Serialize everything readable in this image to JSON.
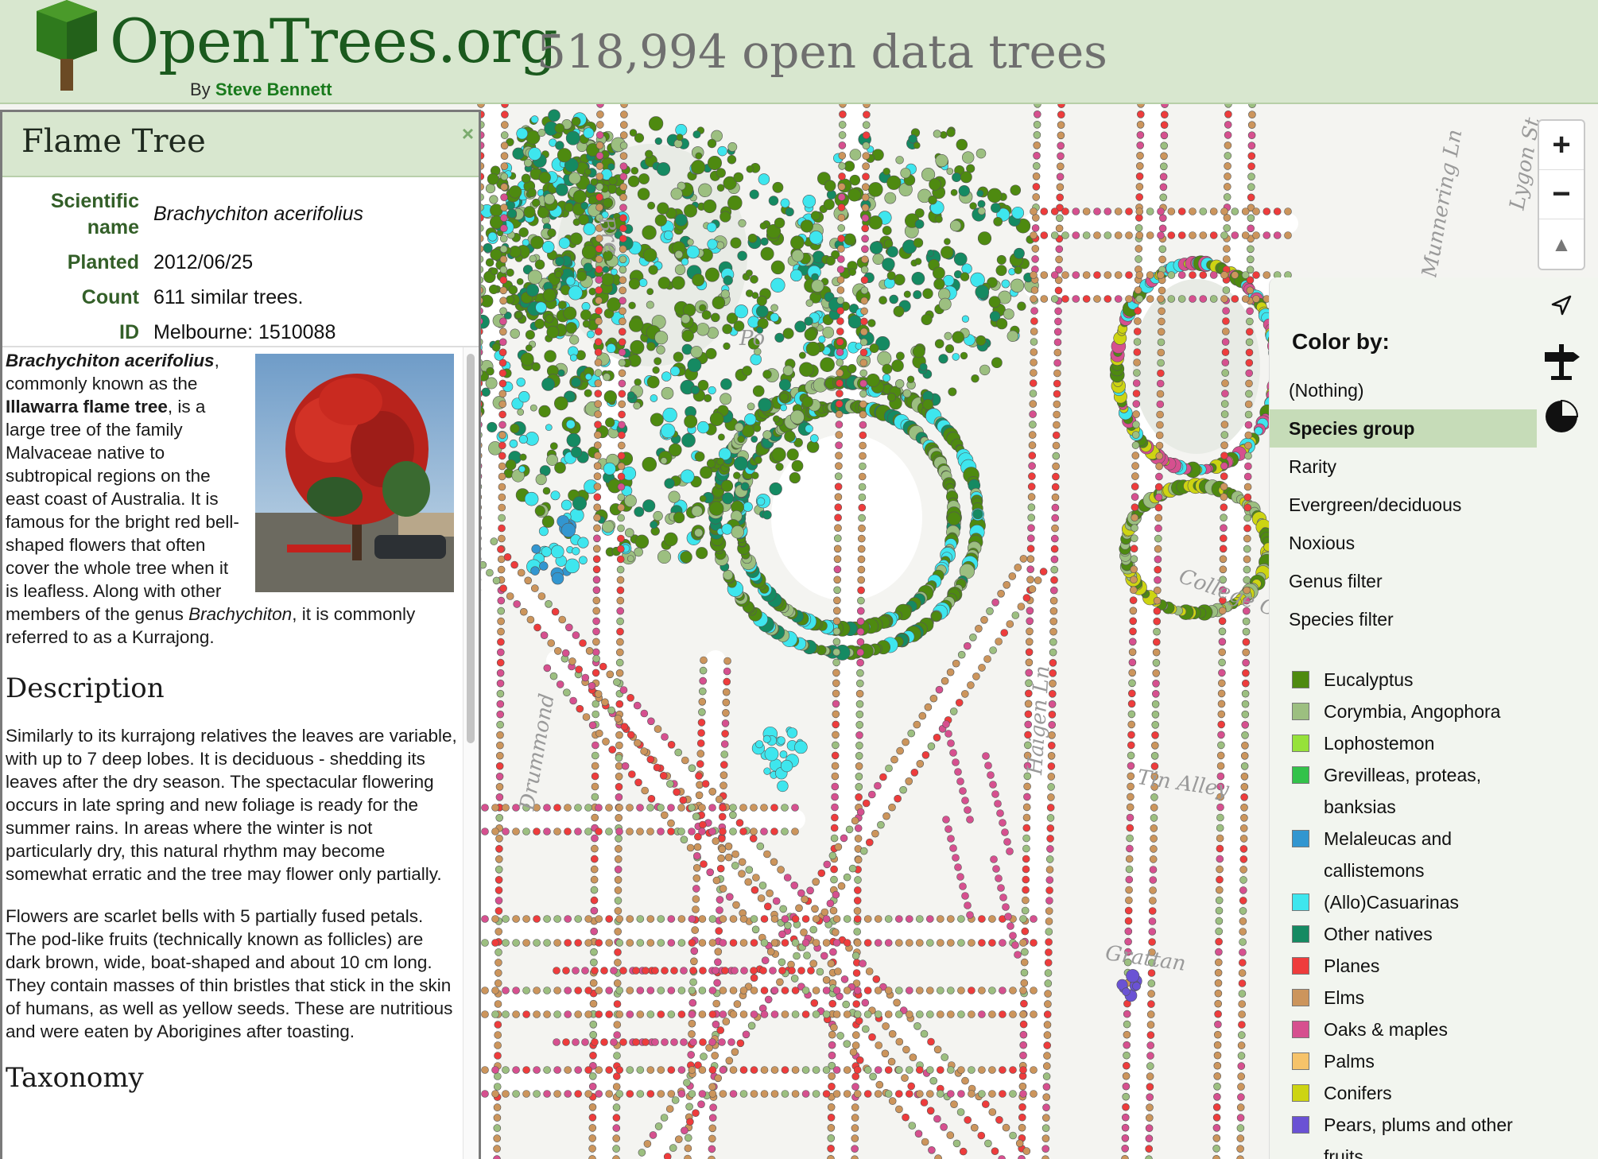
{
  "header": {
    "site_name": "OpenTrees.org",
    "byline_prefix": "By",
    "byline_author": "Steve Bennett",
    "tree_count": "518,994 open data trees"
  },
  "map": {
    "street_labels": [
      "Munnering Ln",
      "Lygon St",
      "Tin Alley",
      "College C",
      "Bre",
      "Po",
      "Drummond",
      "Grattan",
      "Haigen Ln"
    ],
    "zoom": {
      "in": "+",
      "out": "−",
      "north": "▲"
    }
  },
  "info_panel": {
    "title": "Flame Tree",
    "close": "×",
    "facts": [
      {
        "key": "Scientific name",
        "value": "Brachychiton acerifolius"
      },
      {
        "key": "Planted",
        "value": "2012/06/25"
      },
      {
        "key": "Count",
        "value": "611 similar trees."
      },
      {
        "key": "ID",
        "value": "Melbourne: 1510088"
      }
    ],
    "article": {
      "intro_sci": "Brachychiton acerifolius",
      "intro_1": ", commonly known as the ",
      "intro_common": "Illawarra flame tree",
      "intro_2": ", is a large tree of the family Malvaceae native to subtropical regions on the east coast of Australia. It is famous for the bright red bell-shaped flowers that often cover the whole tree when it is leafless. Along with other members of the genus ",
      "intro_genus": "Brachychiton",
      "intro_3": ", it is commonly referred to as a Kurrajong.",
      "description_heading": "Description",
      "description_1": "Similarly to its kurrajong relatives the leaves are variable, with up to 7 deep lobes. It is deciduous - shedding its leaves after the dry season. The spectacular flowering occurs in late spring and new foliage is ready for the summer rains. In areas where the winter is not particularly dry, this natural rhythm may become somewhat erratic and the tree may flower only partially.",
      "description_2": "Flowers are scarlet bells with 5 partially fused petals. The pod-like fruits (technically known as follicles) are dark brown, wide, boat-shaped and about 10 cm long. They contain masses of thin bristles that stick in the skin of humans, as well as yellow seeds. These are nutritious and were eaten by Aborigines after toasting.",
      "taxonomy_heading": "Taxonomy"
    }
  },
  "color_panel": {
    "title": "Color by:",
    "options": [
      {
        "label": "(Nothing)",
        "selected": false
      },
      {
        "label": "Species group",
        "selected": true
      },
      {
        "label": "Rarity",
        "selected": false
      },
      {
        "label": "Evergreen/deciduous",
        "selected": false
      },
      {
        "label": "Noxious",
        "selected": false
      },
      {
        "label": "Genus filter",
        "selected": false
      },
      {
        "label": "Species filter",
        "selected": false
      }
    ],
    "legend": [
      {
        "label": "Eucalyptus",
        "color": "#4e8a10"
      },
      {
        "label": "Corymbia, Angophora",
        "color": "#9cbf80"
      },
      {
        "label": "Lophostemon",
        "color": "#96e23a"
      },
      {
        "label": "Grevilleas, proteas, banksias",
        "color": "#33c24a"
      },
      {
        "label": "Melaleucas and callistemons",
        "color": "#3296d0"
      },
      {
        "label": "(Allo)Casuarinas",
        "color": "#3ee6ee"
      },
      {
        "label": "Other natives",
        "color": "#158a62"
      },
      {
        "label": "Planes",
        "color": "#ee3c3c"
      },
      {
        "label": "Elms",
        "color": "#cc955c"
      },
      {
        "label": "Oaks & maples",
        "color": "#d6508f"
      },
      {
        "label": "Palms",
        "color": "#f6c36a"
      },
      {
        "label": "Conifers",
        "color": "#cdd412"
      },
      {
        "label": "Pears, plums and other fruits",
        "color": "#6a52d4"
      }
    ],
    "tools": [
      "locate-icon",
      "signpost-icon",
      "pie-chart-icon"
    ]
  }
}
